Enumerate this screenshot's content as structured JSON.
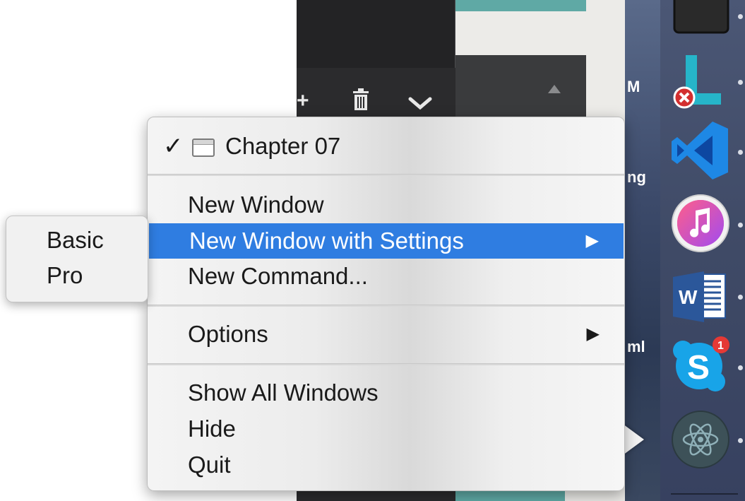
{
  "menu": {
    "current_window": {
      "label": "Chapter 07",
      "checked": true
    },
    "items": [
      {
        "label": "New Window"
      },
      {
        "label": "New Window with Settings",
        "has_submenu": true,
        "highlighted": true
      },
      {
        "label": "New Command..."
      }
    ],
    "options": {
      "label": "Options",
      "has_submenu": true
    },
    "window_items": [
      {
        "label": "Show All Windows"
      },
      {
        "label": "Hide"
      },
      {
        "label": "Quit"
      }
    ],
    "check_glyph": "✓",
    "submenu_arrow": "▶"
  },
  "submenu": {
    "items": [
      {
        "label": "Basic"
      },
      {
        "label": "Pro"
      }
    ]
  },
  "background": {
    "desktop_texts": [
      "M",
      "ng",
      "ml"
    ]
  },
  "dock": {
    "skype_badge": "1",
    "word_letter": "W",
    "skype_letter": "S",
    "icons": [
      "terminal-icon",
      "l-app-icon",
      "vscode-icon",
      "itunes-icon",
      "word-icon",
      "skype-icon",
      "electron-icon"
    ]
  },
  "colors": {
    "highlight": "#2f7de1",
    "dock_bg": "#3f4a66",
    "teal": "#5fa9a5"
  }
}
